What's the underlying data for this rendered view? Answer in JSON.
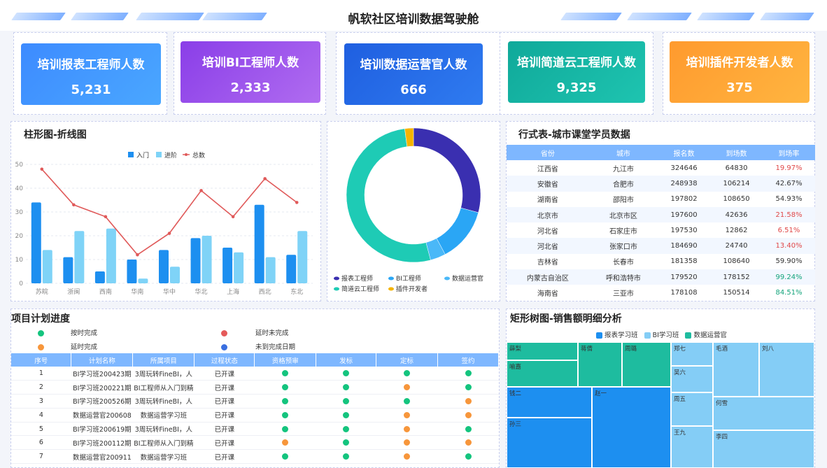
{
  "header": {
    "title": "帆软社区培训数据驾驶舱"
  },
  "kpis": [
    {
      "label": "培训报表工程师人数",
      "value": "5,231",
      "color1": "#3d8bff",
      "color2": "#4aa7ff"
    },
    {
      "label": "培训BI工程师人数",
      "value": "2,333",
      "color1": "#8a3ee8",
      "color2": "#b06cf0"
    },
    {
      "label": "培训数据运营官人数",
      "value": "666",
      "color1": "#1f5fe0",
      "color2": "#2f7bf0"
    },
    {
      "label": "培训简道云工程师人数",
      "value": "9,325",
      "color1": "#10a99a",
      "color2": "#1ec4b0"
    },
    {
      "label": "培训插件开发者人数",
      "value": "375",
      "color1": "#ff9a2e",
      "color2": "#ffb540"
    }
  ],
  "bar_line": {
    "title": "柱形图-折线图",
    "legend": [
      "入门",
      "进阶",
      "总数"
    ]
  },
  "chart_data": [
    {
      "type": "bar",
      "categories": [
        "苏皖",
        "浙闽",
        "西南",
        "华南",
        "华中",
        "华北",
        "上海",
        "西北",
        "东北"
      ],
      "series": [
        {
          "name": "入门",
          "type": "bar",
          "color": "#1d8ff0",
          "values": [
            34,
            11,
            5,
            10,
            14,
            19,
            15,
            33,
            12
          ]
        },
        {
          "name": "进阶",
          "type": "bar",
          "color": "#7fd3f7",
          "values": [
            14,
            22,
            23,
            2,
            7,
            20,
            13,
            11,
            22
          ]
        },
        {
          "name": "总数",
          "type": "line",
          "color": "#e05a5a",
          "values": [
            48,
            33,
            28,
            12,
            21,
            39,
            28,
            44,
            34
          ]
        }
      ],
      "yticks": [
        0,
        10,
        20,
        30,
        40,
        50
      ],
      "ylim": [
        0,
        50
      ]
    },
    {
      "type": "pie",
      "categories": [
        "报表工程师",
        "BI工程师",
        "数据运营官",
        "简道云工程师",
        "插件开发者"
      ],
      "colors": [
        "#3a2fb0",
        "#2aa6f5",
        "#4ab8f8",
        "#1ecbb5",
        "#f5b400"
      ],
      "values": [
        5231,
        2333,
        666,
        9325,
        375
      ]
    }
  ],
  "city_table": {
    "title": "行式表-城市课堂学员数据",
    "headers": [
      "省份",
      "城市",
      "报名数",
      "到场数",
      "到场率"
    ],
    "rows": [
      [
        "江西省",
        "九江市",
        "324646",
        "64830",
        "19.97%"
      ],
      [
        "安徽省",
        "合肥市",
        "248938",
        "106214",
        "42.67%"
      ],
      [
        "湖南省",
        "邵阳市",
        "197802",
        "108650",
        "54.93%"
      ],
      [
        "北京市",
        "北京市区",
        "197600",
        "42636",
        "21.58%"
      ],
      [
        "河北省",
        "石家庄市",
        "197530",
        "12862",
        "6.51%"
      ],
      [
        "河北省",
        "张家口市",
        "184690",
        "24740",
        "13.40%"
      ],
      [
        "吉林省",
        "长春市",
        "181358",
        "108640",
        "59.90%"
      ],
      [
        "内蒙古自治区",
        "呼和浩特市",
        "179520",
        "178152",
        "99.24%"
      ],
      [
        "海南省",
        "三亚市",
        "178108",
        "150514",
        "84.51%"
      ]
    ],
    "rate_colors": [
      "#e04848",
      "#333333",
      "#333333",
      "#e04848",
      "#e04848",
      "#e04848",
      "#333333",
      "#12a37a",
      "#12a37a"
    ]
  },
  "plan": {
    "title": "项目计划进度",
    "legend": [
      {
        "label": "按时完成",
        "color": "#14c47e"
      },
      {
        "label": "延时未完成",
        "color": "#e55a5a"
      },
      {
        "label": "延时完成",
        "color": "#f7963b"
      },
      {
        "label": "未到完成日期",
        "color": "#3a6fe0"
      }
    ],
    "headers": [
      "序号",
      "计划名称",
      "所属项目",
      "过程状态",
      "资格预审",
      "发标",
      "定标",
      "签约"
    ],
    "rows": [
      {
        "no": "1",
        "name": "BI学习班200423期",
        "project": "3周玩转FineBI，人",
        "status": "已开课",
        "dots": [
          "#14c47e",
          "#14c47e",
          "#14c47e",
          "#14c47e"
        ]
      },
      {
        "no": "2",
        "name": "BI学习班200221期",
        "project": "BI工程师从入门到精",
        "status": "已开课",
        "dots": [
          "#14c47e",
          "#14c47e",
          "#f7963b",
          "#14c47e"
        ]
      },
      {
        "no": "3",
        "name": "BI学习班200526期",
        "project": "3周玩转FineBI，人",
        "status": "已开课",
        "dots": [
          "#14c47e",
          "#14c47e",
          "#14c47e",
          "#f7963b"
        ]
      },
      {
        "no": "4",
        "name": "数据运营官200608",
        "project": "数据运营学习班",
        "status": "已开课",
        "dots": [
          "#14c47e",
          "#14c47e",
          "#f7963b",
          "#f7963b"
        ]
      },
      {
        "no": "5",
        "name": "BI学习班200619期",
        "project": "3周玩转FineBI，人",
        "status": "已开课",
        "dots": [
          "#14c47e",
          "#14c47e",
          "#f7963b",
          "#14c47e"
        ]
      },
      {
        "no": "6",
        "name": "BI学习班200112期",
        "project": "BI工程师从入门到精",
        "status": "已开课",
        "dots": [
          "#f7963b",
          "#14c47e",
          "#f7963b",
          "#f7963b"
        ]
      },
      {
        "no": "7",
        "name": "数据运营官200911",
        "project": "数据运营学习班",
        "status": "已开课",
        "dots": [
          "#14c47e",
          "#14c47e",
          "#f7963b",
          "#14c47e"
        ]
      }
    ]
  },
  "treemap": {
    "title": "矩形树图-销售额明细分析",
    "legend": [
      {
        "label": "报表学习班",
        "color": "#1d8ff0"
      },
      {
        "label": "BI学习班",
        "color": "#84cdf6"
      },
      {
        "label": "数据运营官",
        "color": "#1ebc9f"
      }
    ],
    "cells": [
      {
        "label": "薛梨",
        "group": 2
      },
      {
        "label": "蒋倩",
        "group": 2
      },
      {
        "label": "周璐",
        "group": 2
      },
      {
        "label": "喻嘉",
        "group": 2
      },
      {
        "label": "钱二",
        "group": 0
      },
      {
        "label": "赵一",
        "group": 0
      },
      {
        "label": "孙三",
        "group": 0
      },
      {
        "label": "郑七",
        "group": 1
      },
      {
        "label": "吴六",
        "group": 1
      },
      {
        "label": "周五",
        "group": 1
      },
      {
        "label": "王九",
        "group": 1
      },
      {
        "label": "毛酒",
        "group": 1
      },
      {
        "label": "刘八",
        "group": 1
      },
      {
        "label": "何雪",
        "group": 1
      },
      {
        "label": "李四",
        "group": 1
      }
    ]
  }
}
